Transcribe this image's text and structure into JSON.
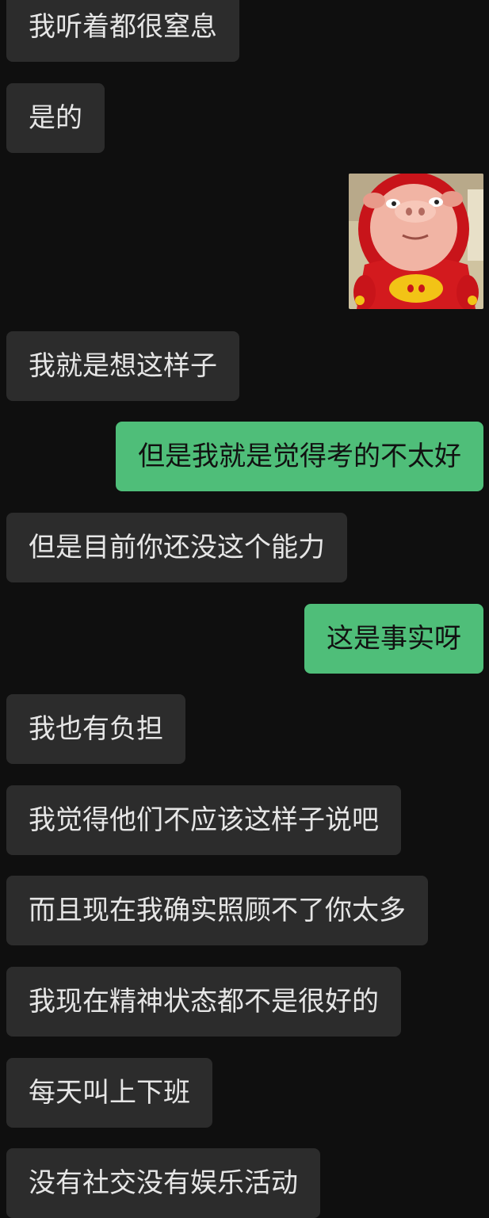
{
  "messages": [
    {
      "side": "in",
      "text": "我听着都很窒息"
    },
    {
      "side": "in",
      "text": "是的"
    },
    {
      "side": "out",
      "type": "sticker",
      "sticker": "pig-mascot-sticker"
    },
    {
      "side": "in",
      "text": "我就是想这样子"
    },
    {
      "side": "out",
      "text": "但是我就是觉得考的不太好"
    },
    {
      "side": "in",
      "text": "但是目前你还没这个能力"
    },
    {
      "side": "out",
      "text": "这是事实呀"
    },
    {
      "side": "in",
      "text": "我也有负担"
    },
    {
      "side": "in",
      "text": "我觉得他们不应该这样子说吧"
    },
    {
      "side": "in",
      "text": "而且现在我确实照顾不了你太多"
    },
    {
      "side": "in",
      "text": "我现在精神状态都不是很好的"
    },
    {
      "side": "in",
      "text": "每天叫上下班"
    },
    {
      "side": "in",
      "text": "没有社交没有娱乐活动"
    }
  ],
  "colors": {
    "background": "#0f0f0f",
    "incoming_bubble": "#2c2c2c",
    "outgoing_bubble": "#4fbe79"
  }
}
